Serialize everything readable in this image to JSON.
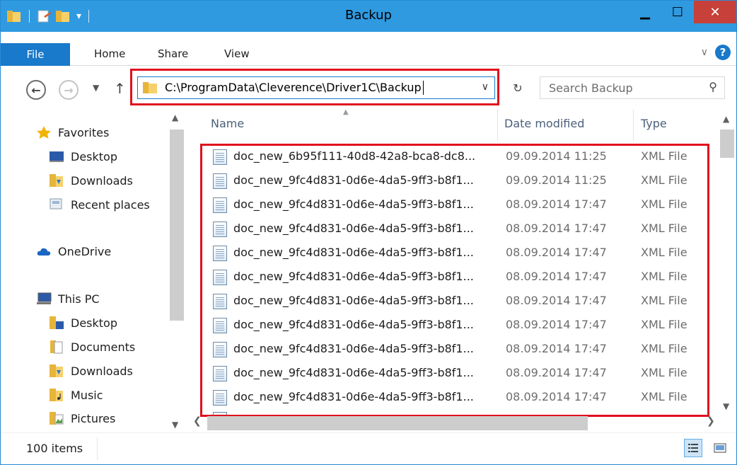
{
  "window": {
    "title": "Backup"
  },
  "ribbon": {
    "file": "File",
    "tabs": [
      "Home",
      "Share",
      "View"
    ],
    "help_glyph": "?"
  },
  "address": {
    "path": "C:\\ProgramData\\Cleverence\\Driver1C\\Backup"
  },
  "search": {
    "placeholder": "Search Backup"
  },
  "nav": {
    "favorites": "Favorites",
    "fav_items": [
      "Desktop",
      "Downloads",
      "Recent places"
    ],
    "onedrive": "OneDrive",
    "this_pc": "This PC",
    "pc_items": [
      "Desktop",
      "Documents",
      "Downloads",
      "Music",
      "Pictures"
    ]
  },
  "columns": {
    "name": "Name",
    "date": "Date modified",
    "type": "Type"
  },
  "files": [
    {
      "name": "doc_new_6b95f111-40d8-42a8-bca8-dc8...",
      "date": "09.09.2014 11:25",
      "type": "XML File"
    },
    {
      "name": "doc_new_9fc4d831-0d6e-4da5-9ff3-b8f1...",
      "date": "09.09.2014 11:25",
      "type": "XML File"
    },
    {
      "name": "doc_new_9fc4d831-0d6e-4da5-9ff3-b8f1...",
      "date": "08.09.2014 17:47",
      "type": "XML File"
    },
    {
      "name": "doc_new_9fc4d831-0d6e-4da5-9ff3-b8f1...",
      "date": "08.09.2014 17:47",
      "type": "XML File"
    },
    {
      "name": "doc_new_9fc4d831-0d6e-4da5-9ff3-b8f1...",
      "date": "08.09.2014 17:47",
      "type": "XML File"
    },
    {
      "name": "doc_new_9fc4d831-0d6e-4da5-9ff3-b8f1...",
      "date": "08.09.2014 17:47",
      "type": "XML File"
    },
    {
      "name": "doc_new_9fc4d831-0d6e-4da5-9ff3-b8f1...",
      "date": "08.09.2014 17:47",
      "type": "XML File"
    },
    {
      "name": "doc_new_9fc4d831-0d6e-4da5-9ff3-b8f1...",
      "date": "08.09.2014 17:47",
      "type": "XML File"
    },
    {
      "name": "doc_new_9fc4d831-0d6e-4da5-9ff3-b8f1...",
      "date": "08.09.2014 17:47",
      "type": "XML File"
    },
    {
      "name": "doc_new_9fc4d831-0d6e-4da5-9ff3-b8f1...",
      "date": "08.09.2014 17:47",
      "type": "XML File"
    },
    {
      "name": "doc_new_9fc4d831-0d6e-4da5-9ff3-b8f1...",
      "date": "08.09.2014 17:47",
      "type": "XML File"
    }
  ],
  "status": {
    "count": "100 items"
  },
  "colors": {
    "titlebar": "#2f9ae0",
    "file_tab": "#1979ca",
    "close": "#c7403a",
    "highlight": "#e0101e"
  }
}
